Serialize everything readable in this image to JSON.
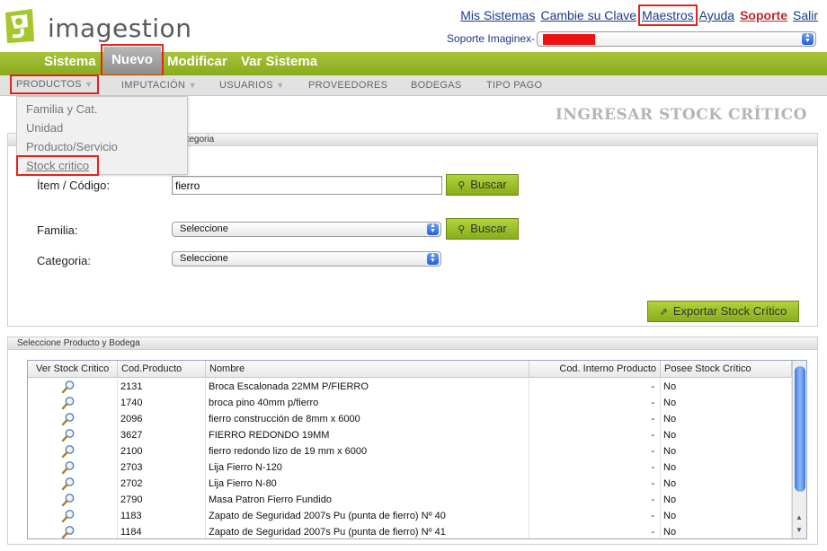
{
  "header": {
    "logo_text": "imagestion",
    "links": [
      {
        "label": "Mis Sistemas",
        "name": "link-mis-sistemas",
        "highlight": false,
        "style": "normal"
      },
      {
        "label": "Cambie su Clave",
        "name": "link-cambie-clave",
        "highlight": false,
        "style": "normal"
      },
      {
        "label": "Maestros",
        "name": "link-maestros",
        "highlight": true,
        "style": "normal"
      },
      {
        "label": "Ayuda",
        "name": "link-ayuda",
        "highlight": false,
        "style": "normal"
      },
      {
        "label": "Soporte",
        "name": "link-soporte",
        "highlight": false,
        "style": "soporte"
      },
      {
        "label": "Salir",
        "name": "link-salir",
        "highlight": false,
        "style": "normal"
      }
    ],
    "soporte_label": "Soporte Imaginex-"
  },
  "mainnav": [
    "Sistema",
    "Nuevo",
    "Modificar",
    "Var Sistema"
  ],
  "subnav": [
    {
      "label": "PRODUCTOS",
      "caret": true
    },
    {
      "label": "IMPUTACIÓN",
      "caret": true
    },
    {
      "label": "USUARIOS",
      "caret": true
    },
    {
      "label": "PROVEEDORES",
      "caret": false
    },
    {
      "label": "BODEGAS",
      "caret": false
    },
    {
      "label": "TIPO PAGO",
      "caret": false
    }
  ],
  "dropdown": [
    "Familia y Cat.",
    "Unidad",
    "Producto/Servicio",
    "Stock critico"
  ],
  "page_title": "INGRESAR STOCK CRÍTICO",
  "search_panel": {
    "header_label": "ategoria",
    "item_label": "Ítem / Código:",
    "item_value": "fierro",
    "familia_label": "Familia:",
    "categoria_label": "Categoria:",
    "select_placeholder": "Seleccione",
    "buscar_label": "Buscar",
    "export_label": "Exportar Stock Crítico"
  },
  "results_panel": {
    "header_label": "Seleccione Producto y Bodega",
    "columns": [
      "Ver Stock Critico",
      "Cod.Producto",
      "Nombre",
      "Cod. Interno Producto",
      "Posee Stock Crítico"
    ],
    "rows": [
      [
        "2131",
        "Broca Escalonada 22MM P/FIERRO",
        "-",
        "No"
      ],
      [
        "1740",
        "broca pino 40mm p/fierro",
        "-",
        "No"
      ],
      [
        "2096",
        "fierro construcción de 8mm x 6000",
        "-",
        "No"
      ],
      [
        "3627",
        "FIERRO REDONDO 19MM",
        "-",
        "No"
      ],
      [
        "2100",
        "fierro redondo lizo de 19 mm x 6000",
        "-",
        "No"
      ],
      [
        "2703",
        "Lija Fierro N-120",
        "-",
        "No"
      ],
      [
        "2702",
        "Lija Fierro N-80",
        "-",
        "No"
      ],
      [
        "2790",
        "Masa Patron Fierro Fundido",
        "-",
        "No"
      ],
      [
        "1183",
        "Zapato de Seguridad 2007s Pu (punta de fierro) Nº 40",
        "-",
        "No"
      ],
      [
        "1184",
        "Zapato de Seguridad 2007s Pu (punta de fierro) Nº 41",
        "-",
        "No"
      ]
    ]
  },
  "colors": {
    "accent_green": "#97b52a",
    "link_blue": "#1c3a8a",
    "soporte_red": "#c0282c",
    "highlight_red": "#e3231c"
  }
}
